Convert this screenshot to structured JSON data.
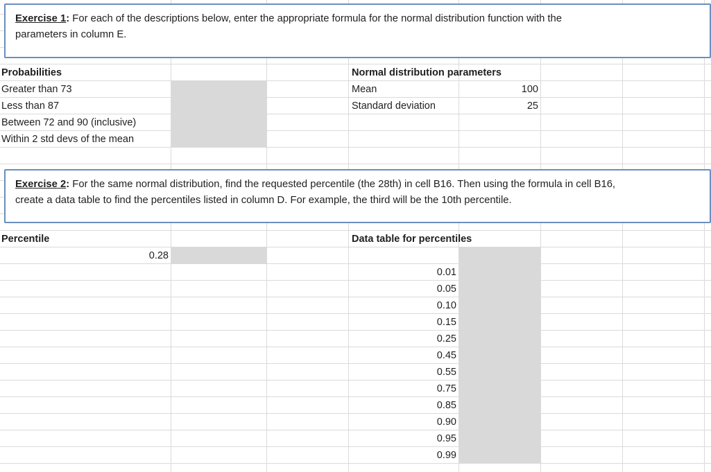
{
  "exercise1": {
    "label": "Exercise 1",
    "line1": "For each of the descriptions below, enter the appropriate formula for the normal distribution function with the",
    "line2": "parameters in column E."
  },
  "probabilities": {
    "header": "Probabilities",
    "items": [
      "Greater than 73",
      "Less than 87",
      "Between 72 and 90 (inclusive)",
      "Within 2 std devs of the mean"
    ]
  },
  "params": {
    "header": "Normal distribution parameters",
    "mean_label": "Mean",
    "mean_value": "100",
    "sd_label": "Standard deviation",
    "sd_value": "25"
  },
  "exercise2": {
    "label": "Exercise 2",
    "line1": "For the same normal distribution, find the requested percentile (the 28th) in cell B16. Then using the formula in cell B16,",
    "line2": "create a data table to find the percentiles listed in column D. For example, the third will be the 10th percentile."
  },
  "percentile": {
    "header": "Percentile",
    "value": "0.28"
  },
  "data_table": {
    "header": "Data table for percentiles",
    "values": [
      "0.01",
      "0.05",
      "0.10",
      "0.15",
      "0.25",
      "0.45",
      "0.55",
      "0.75",
      "0.85",
      "0.90",
      "0.95",
      "0.99"
    ]
  }
}
